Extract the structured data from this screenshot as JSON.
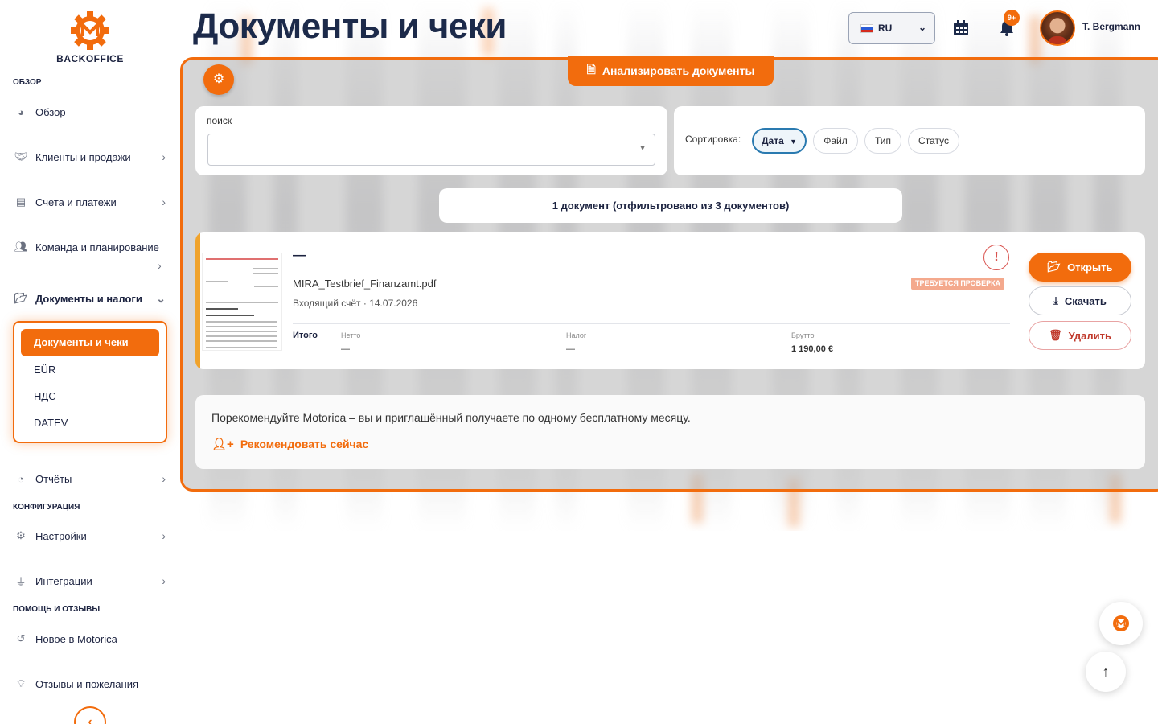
{
  "app": {
    "brand": "BACKOFFICE",
    "accent_color": "#f26c0d"
  },
  "sidebar": {
    "section_overview": "ОБЗОР",
    "overview": "Обзор",
    "clients": "Клиенты и продажи",
    "invoices": "Счета и платежи",
    "team": "Команда и планирование",
    "documents": "Документы и налоги",
    "sub_docs": "Документы и чеки",
    "sub_eur": "EÜR",
    "sub_vat": "НДС",
    "sub_datev": "DATEV",
    "reports": "Отчёты",
    "section_config": "КОНФИГУРАЦИЯ",
    "settings": "Настройки",
    "integrations": "Интеграции",
    "section_help": "ПОМОЩЬ И ОТЗЫВЫ",
    "whats_new": "Новое в Motorica",
    "feedback": "Отзывы и пожелания",
    "collapse_icon": "‹"
  },
  "header": {
    "title": "Документы и чеки",
    "language": "RU",
    "notifications_badge": "9+",
    "user_name": "T. Bergmann"
  },
  "toolbar": {
    "analyze_label": "Анализировать документы"
  },
  "search": {
    "label": "поиск",
    "value": ""
  },
  "sort": {
    "label": "Сортировка:",
    "options": [
      "Дата",
      "Файл",
      "Тип",
      "Статус"
    ],
    "selected": "Дата",
    "selected_arrow": "▼"
  },
  "results": {
    "summary": "1 документ (отфильтровано из 3 документов)"
  },
  "document": {
    "title": "—",
    "filename": "MIRA_Testbrief_Finanzamt.pdf",
    "meta": "Входящий счёт · 14.07.2026",
    "status": "ТРЕБУЕТСЯ ПРОВЕРКА",
    "warning_icon": "!",
    "totals_label": "Итого",
    "net_label": "Нетто",
    "net_value": "—",
    "tax_label": "Налог",
    "tax_value": "—",
    "gross_label": "Брутто",
    "gross_value": "1 190,00 €",
    "open_label": "Открыть",
    "download_label": "Скачать",
    "delete_label": "Удалить"
  },
  "referral": {
    "text": "Порекомендуйте Motorica – вы и приглашённый получаете по одному бесплатному месяцу.",
    "link": "Рекомендовать сейчас"
  }
}
